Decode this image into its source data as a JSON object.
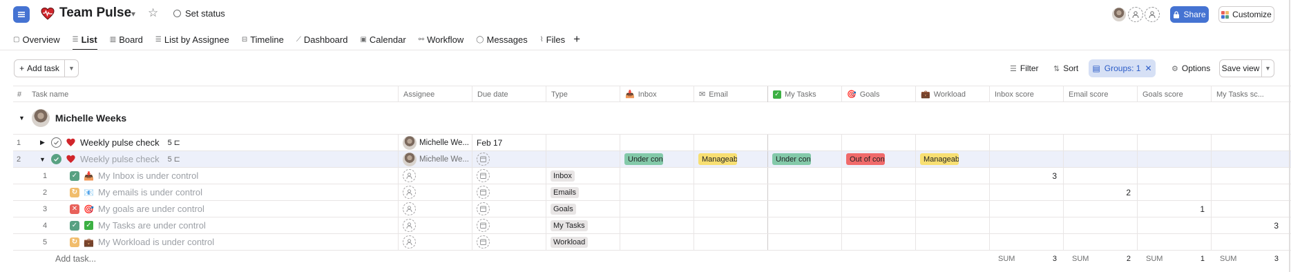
{
  "header": {
    "project_title": "Team Pulse",
    "set_status_label": "Set status",
    "share_label": "Share",
    "customize_label": "Customize"
  },
  "tabs": [
    {
      "label": "Overview",
      "icon": "overview-icon"
    },
    {
      "label": "List",
      "icon": "list-icon",
      "active": true
    },
    {
      "label": "Board",
      "icon": "board-icon"
    },
    {
      "label": "List by Assignee",
      "icon": "list-icon"
    },
    {
      "label": "Timeline",
      "icon": "timeline-icon"
    },
    {
      "label": "Dashboard",
      "icon": "dashboard-icon"
    },
    {
      "label": "Calendar",
      "icon": "calendar-icon"
    },
    {
      "label": "Workflow",
      "icon": "workflow-icon"
    },
    {
      "label": "Messages",
      "icon": "messages-icon"
    },
    {
      "label": "Files",
      "icon": "paperclip-icon"
    }
  ],
  "toolbar": {
    "add_task_label": "Add task",
    "filter_label": "Filter",
    "sort_label": "Sort",
    "groups_label": "Groups: 1",
    "options_label": "Options",
    "save_view_label": "Save view"
  },
  "columns": {
    "num": "#",
    "task_name": "Task name",
    "assignee": "Assignee",
    "due_date": "Due date",
    "type": "Type",
    "inbox": "Inbox",
    "email": "Email",
    "my_tasks": "My Tasks",
    "goals": "Goals",
    "workload": "Workload",
    "inbox_score": "Inbox score",
    "email_score": "Email score",
    "goals_score": "Goals score",
    "my_tasks_score": "My Tasks sc..."
  },
  "section": {
    "name": "Michelle Weeks"
  },
  "rows": [
    {
      "num": "1",
      "name": "Weekly pulse check",
      "subtasks": "5",
      "assignee": "Michelle We...",
      "due": "Feb 17"
    },
    {
      "num": "2",
      "name": "Weekly pulse check",
      "subtasks": "5",
      "assignee": "Michelle We...",
      "inbox": "Under con...",
      "email": "Manageable",
      "my_tasks": "Under con...",
      "goals": "Out of con...",
      "workload": "Manageable"
    }
  ],
  "subtasks": [
    {
      "num": "1",
      "name": "My Inbox is under control",
      "type": "Inbox",
      "inbox_score": "3",
      "status_color": "#58a182",
      "mark": "✓"
    },
    {
      "num": "2",
      "name": "My emails is under control",
      "type": "Emails",
      "email_score": "2",
      "status_color": "#f1bd6c",
      "mark": "↻"
    },
    {
      "num": "3",
      "name": "My goals are under control",
      "type": "Goals",
      "goals_score": "1",
      "status_color": "#e8615a",
      "mark": "✕"
    },
    {
      "num": "4",
      "name": "My Tasks are under control",
      "type": "My Tasks",
      "my_tasks_score": "3",
      "status_color": "#58a182",
      "mark": "✓"
    },
    {
      "num": "5",
      "name": "My Workload is under control",
      "type": "Workload",
      "status_color": "#f1bd6c",
      "mark": "↻"
    }
  ],
  "footer": {
    "add_task_label": "Add task...",
    "sum_label": "SUM",
    "inbox_sum": "3",
    "email_sum": "2",
    "goals_sum": "1",
    "my_tasks_sum": "3"
  },
  "colors": {
    "accent": "#4573d2",
    "green": "#58a182",
    "yellow": "#f1bd6c",
    "red": "#e8615a",
    "pill_green": "#83c9a9",
    "pill_yellow": "#f8df72",
    "pill_red": "#f06a6a"
  }
}
